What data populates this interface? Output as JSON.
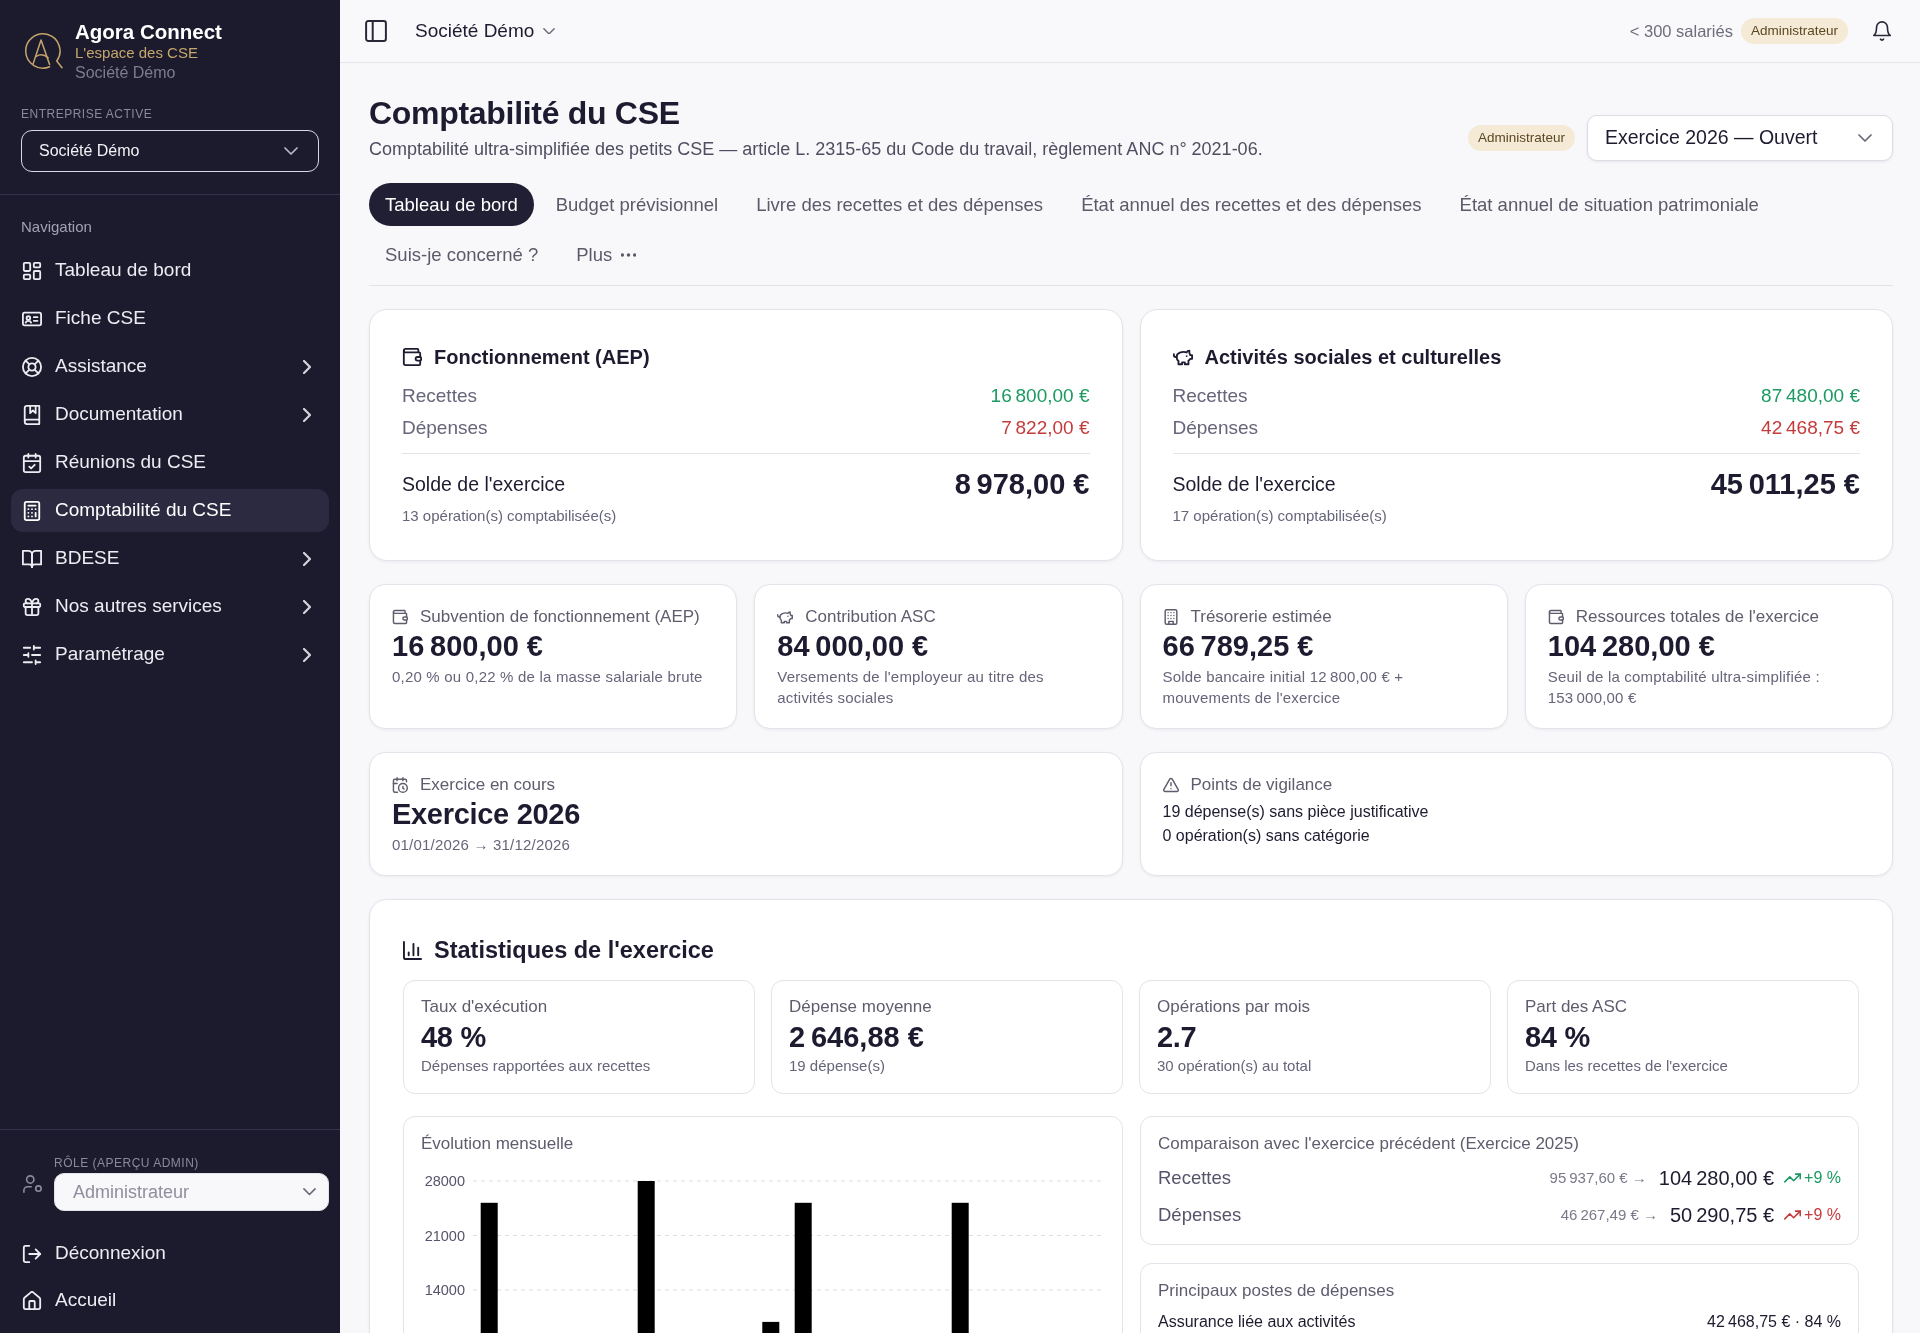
{
  "sidebar": {
    "brand": {
      "name": "Agora Connect",
      "tagline": "L'espace des CSE",
      "company": "Société Démo"
    },
    "company_select": {
      "label": "ENTREPRISE ACTIVE",
      "value": "Société Démo"
    },
    "nav_heading": "Navigation",
    "nav_items": [
      {
        "label": "Tableau de bord",
        "selected": false,
        "expandable": false
      },
      {
        "label": "Fiche CSE",
        "selected": false,
        "expandable": false
      },
      {
        "label": "Assistance",
        "selected": false,
        "expandable": true
      },
      {
        "label": "Documentation",
        "selected": false,
        "expandable": true
      },
      {
        "label": "Réunions du CSE",
        "selected": false,
        "expandable": false
      },
      {
        "label": "Comptabilité du CSE",
        "selected": true,
        "expandable": false
      },
      {
        "label": "BDESE",
        "selected": false,
        "expandable": true
      },
      {
        "label": "Nos autres services",
        "selected": false,
        "expandable": true
      },
      {
        "label": "Paramétrage",
        "selected": false,
        "expandable": true
      }
    ],
    "role_select": {
      "label": "RÔLE (APERÇU ADMIN)",
      "value": "Administrateur",
      "disabled": true
    },
    "footer_items": [
      {
        "label": "Déconnexion"
      },
      {
        "label": "Accueil"
      }
    ]
  },
  "top_bar": {
    "company": "Société Démo",
    "headcount": "< 300 salariés",
    "role_badge": "Administrateur"
  },
  "header": {
    "title": "Comptabilité du CSE",
    "subtitle": "Comptabilité ultra-simplifiée des petits CSE — article L. 2315-65 du Code du travail, règlement ANC n° 2021-06.",
    "role_badge": "Administrateur",
    "exercise_select": "Exercice 2026 — Ouvert"
  },
  "tabs": [
    {
      "label": "Tableau de bord",
      "selected": true,
      "kind": "link"
    },
    {
      "label": "Budget prévisionnel",
      "selected": false,
      "kind": "link"
    },
    {
      "label": "Livre des recettes et des dépenses",
      "selected": false,
      "kind": "link"
    },
    {
      "label": "État annuel des recettes et des dépenses",
      "selected": false,
      "kind": "link"
    },
    {
      "label": "État annuel de situation patrimoniale",
      "selected": false,
      "kind": "link"
    },
    {
      "label": "Suis-je concerné ?",
      "selected": false,
      "kind": "link"
    },
    {
      "label": "Plus",
      "selected": false,
      "kind": "menu"
    }
  ],
  "budget_cards": [
    {
      "title": "Fonctionnement (AEP)",
      "rows": [
        {
          "label": "Recettes",
          "value": "16 800,00 €",
          "kind": "income"
        },
        {
          "label": "Dépenses",
          "value": "7 822,00 €",
          "kind": "expense"
        }
      ],
      "balance_label": "Solde de l'exercice",
      "balance": "8 978,00 €",
      "note": "13 opération(s) comptabilisée(s)"
    },
    {
      "title": "Activités sociales et culturelles",
      "rows": [
        {
          "label": "Recettes",
          "value": "87 480,00 €",
          "kind": "income"
        },
        {
          "label": "Dépenses",
          "value": "42 468,75 €",
          "kind": "expense"
        }
      ],
      "balance_label": "Solde de l'exercice",
      "balance": "45 011,25 €",
      "note": "17 opération(s) comptabilisée(s)"
    }
  ],
  "summary_cards": [
    {
      "title": "Subvention de fonctionnement (AEP)",
      "value": "16 800,00 €",
      "description": "0,20 % ou 0,22 % de la masse salariale brute"
    },
    {
      "title": "Contribution ASC",
      "value": "84 000,00 €",
      "description": "Versements de l'employeur au titre des activités sociales"
    },
    {
      "title": "Trésorerie estimée",
      "value": "66 789,25 €",
      "description": "Solde bancaire initial 12 800,00 € + mouvements de l'exercice"
    },
    {
      "title": "Ressources totales de l'exercice",
      "value": "104 280,00 €",
      "description": "Seuil de la comptabilité ultra-simplifiée : 153 000,00 €"
    }
  ],
  "current_exercise": {
    "label": "Exercice en cours",
    "value": "Exercice 2026",
    "period": "01/01/2026 → 31/12/2026"
  },
  "vigilance": {
    "label": "Points de vigilance",
    "items": [
      "19 dépense(s) sans pièce justificative",
      "0 opération(s) sans catégorie"
    ]
  },
  "statistics": {
    "title": "Statistiques de l'exercice",
    "tiles": [
      {
        "label": "Taux d'exécution",
        "value": "48 %",
        "description": "Dépenses rapportées aux recettes"
      },
      {
        "label": "Dépense moyenne",
        "value": "2 646,88 €",
        "description": "19 dépense(s)"
      },
      {
        "label": "Opérations par mois",
        "value": "2.7",
        "description": "30 opération(s) au total"
      },
      {
        "label": "Part des ASC",
        "value": "84 %",
        "description": "Dans les recettes de l'exercice"
      }
    ],
    "monthly": {
      "title": "Évolution mensuelle",
      "chart_data": {
        "type": "bar",
        "ylim": [
          0,
          28000
        ],
        "yticks": [
          14000,
          21000,
          28000
        ],
        "series": [
          {
            "color": "#000000",
            "values": [
              25200,
              null,
              null,
              28000,
              null,
              null,
              25200,
              null,
              null,
              25200,
              null,
              null
            ]
          },
          {
            "color": "#000000",
            "values": [
              null,
              null,
              null,
              null,
              null,
              9900,
              null,
              null,
              null,
              null,
              null,
              null
            ]
          }
        ]
      }
    },
    "comparison": {
      "title": "Comparaison avec l'exercice précédent (Exercice 2025)",
      "rows": [
        {
          "label": "Recettes",
          "previous": "95 937,60 € →",
          "current": "104 280,00 €",
          "change": "+9 %",
          "rising": true,
          "kind": "income"
        },
        {
          "label": "Dépenses",
          "previous": "46 267,49 € →",
          "current": "50 290,75 €",
          "change": "+9 %",
          "rising": true,
          "kind": "expense"
        }
      ]
    },
    "top_expenses": {
      "title": "Principaux postes de dépenses",
      "items": [
        {
          "label": "Assurance liée aux activités",
          "value": "42 468,75 € · 84 %"
        }
      ]
    }
  }
}
